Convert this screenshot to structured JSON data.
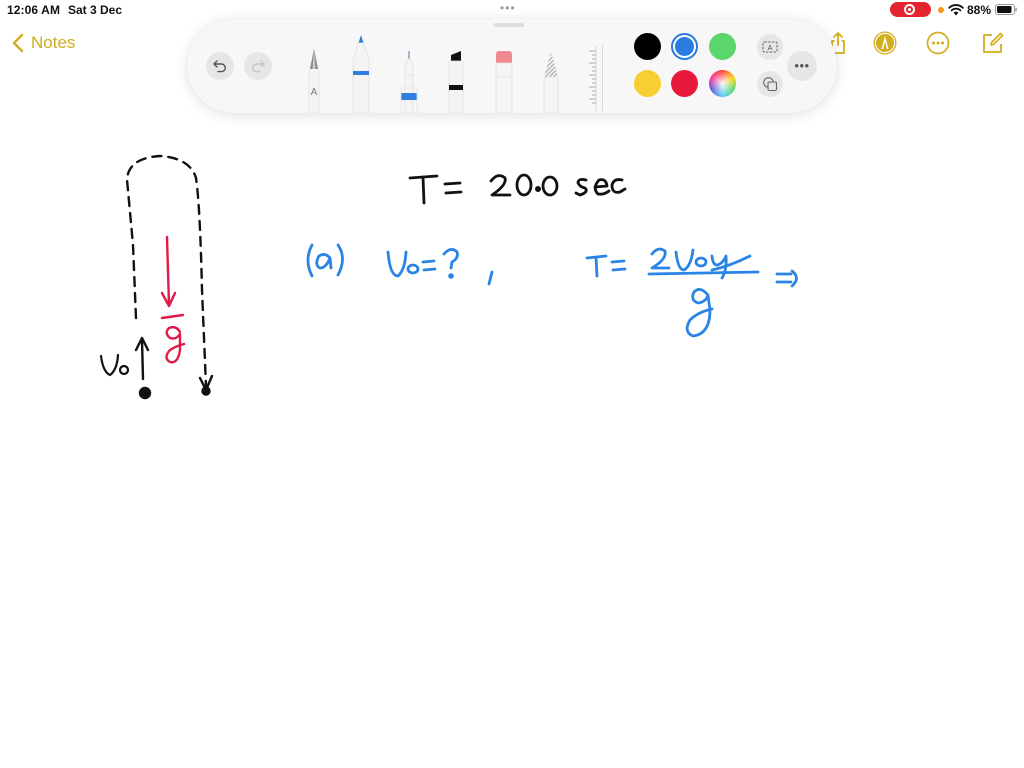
{
  "status_bar": {
    "time": "12:06 AM",
    "date": "Sat 3 Dec",
    "multitask_dots": "•••",
    "recording_indicator": "screen-recording-icon",
    "battery_percent": "88%",
    "battery_level": 0.88,
    "wifi": "wifi-icon",
    "privacy_dot_color": "#f49a1e"
  },
  "nav_bar": {
    "back_label": "Notes",
    "accent_color": "#d2ad1c",
    "icons": [
      "share-icon",
      "markup-pen-icon",
      "more-icon",
      "compose-icon"
    ]
  },
  "palette": {
    "undo": "undo-icon",
    "redo": "redo-icon",
    "tools": [
      {
        "name": "monoline-pen",
        "label": "A"
      },
      {
        "name": "pen",
        "band_color": "#2f7fe0"
      },
      {
        "name": "fineliner",
        "band_color": "#2f7fe0"
      },
      {
        "name": "marker",
        "band_color": "#111111"
      },
      {
        "name": "eraser",
        "tip_color": "#ee8a90"
      },
      {
        "name": "pencil"
      },
      {
        "name": "ruler"
      }
    ],
    "colors": [
      {
        "name": "black",
        "hex": "#000000",
        "selected": false
      },
      {
        "name": "blue",
        "hex": "#2a7ce0",
        "selected": true
      },
      {
        "name": "green",
        "hex": "#5ad66a",
        "selected": false
      },
      {
        "name": "yellow",
        "hex": "#f8cf32",
        "selected": false
      },
      {
        "name": "red",
        "hex": "#e8193c",
        "selected": false
      },
      {
        "name": "multicolor",
        "hex": "picker",
        "selected": false
      }
    ],
    "text_box": "text-box-icon",
    "shapes": "shapes-icon",
    "more": "•••"
  },
  "note": {
    "ink_colors": {
      "black": "#111111",
      "blue": "#2a84e6",
      "red": "#e0194a"
    },
    "diagram": {
      "initial_velocity_label": "v₀",
      "gravity_label": "g⃗"
    },
    "given": "T = 20.0 sec",
    "part_a": {
      "label": "(a)",
      "unknown": "v₀ = ?",
      "separator": ",",
      "formula_lhs": "T =",
      "formula_numerator": "2v₀y",
      "formula_denominator": "g",
      "implies": "⇒"
    }
  }
}
